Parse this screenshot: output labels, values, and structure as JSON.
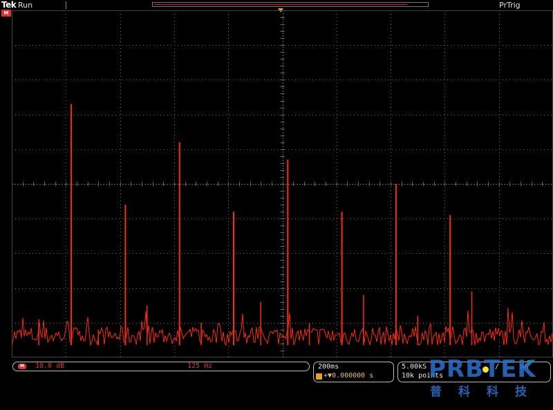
{
  "topbar": {
    "brand": "Tek",
    "status": "Run",
    "trigger_status": "PrTrig",
    "channel_marker": "M",
    "record_position_percent": 50
  },
  "status_bar": {
    "channel_label": "M",
    "vertical_scale": "10.0 dB",
    "center_frequency": "125 Hz",
    "time_per_div": "200ms",
    "trigger_delay": "+▼0.000000 s",
    "sample_rate": "5.00kS",
    "record_length": "10k points",
    "trigger_slope": "/",
    "trigger_level": "mA"
  },
  "logo": {
    "text": "PRBTEK",
    "cn": "普科科技"
  },
  "colors": {
    "trace": "#ff2a10",
    "grid": "#6a6a5a",
    "trigger_marker": "#e5a020",
    "accent_blue": "#2f6fc8"
  },
  "chart_data": {
    "type": "line",
    "title": "",
    "xlabel": "",
    "ylabel": "",
    "grid": true,
    "divisions": {
      "x": 10,
      "y": 10
    },
    "ylim": [
      0,
      10
    ],
    "peaks": [
      {
        "x": 1.1,
        "y": 7.3
      },
      {
        "x": 2.1,
        "y": 4.4
      },
      {
        "x": 3.1,
        "y": 6.2
      },
      {
        "x": 4.1,
        "y": 4.2
      },
      {
        "x": 5.1,
        "y": 5.7
      },
      {
        "x": 6.1,
        "y": 4.2
      },
      {
        "x": 7.1,
        "y": 5.0
      },
      {
        "x": 8.1,
        "y": 4.1
      }
    ],
    "minor_peaks": [
      {
        "x": 0.5,
        "y": 1.1
      },
      {
        "x": 1.6,
        "y": 0.8
      },
      {
        "x": 2.5,
        "y": 1.5
      },
      {
        "x": 3.5,
        "y": 1.0
      },
      {
        "x": 4.6,
        "y": 1.6
      },
      {
        "x": 5.5,
        "y": 1.0
      },
      {
        "x": 6.5,
        "y": 1.8
      },
      {
        "x": 7.5,
        "y": 1.2
      },
      {
        "x": 8.5,
        "y": 1.9
      }
    ],
    "noise_floor": 0.35
  }
}
